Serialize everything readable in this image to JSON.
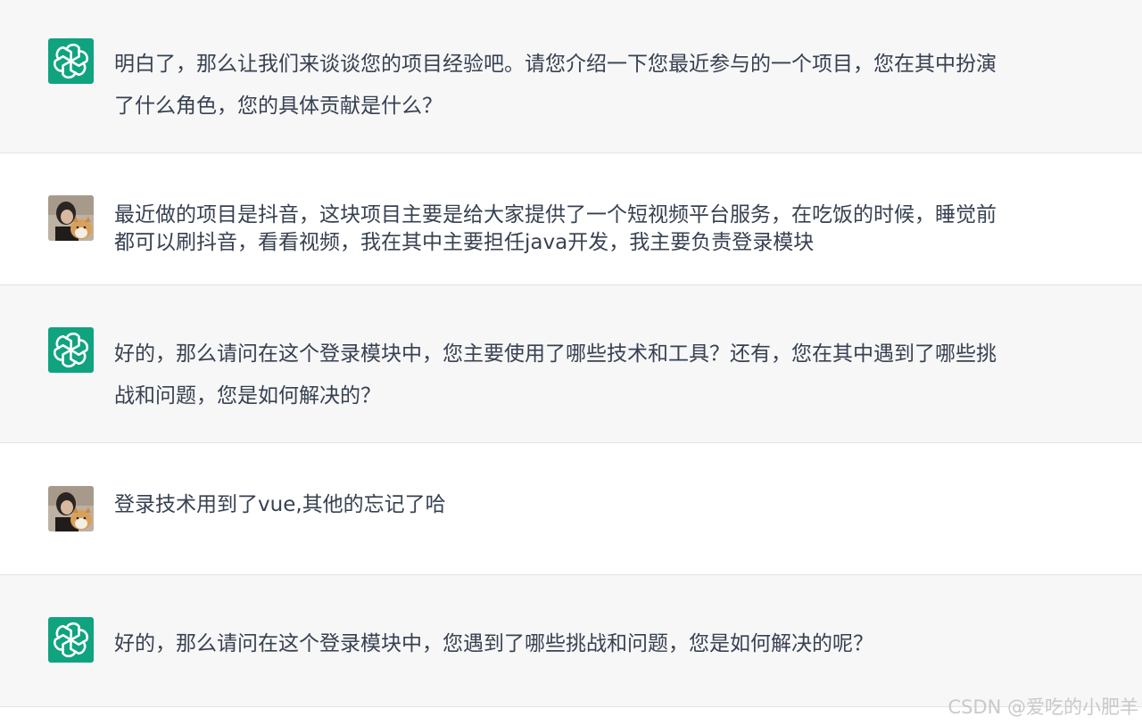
{
  "messages": [
    {
      "role": "assistant",
      "avatar_icon": "openai-logo-icon",
      "text": "明白了，那么让我们来谈谈您的项目经验吧。请您介绍一下您最近参与的一个项目，您在其中扮演了什么角色，您的具体贡献是什么？"
    },
    {
      "role": "user",
      "avatar_icon": "user-avatar-photo",
      "text": "最近做的项目是抖音，这块项目主要是给大家提供了一个短视频平台服务，在吃饭的时候，睡觉前都可以刷抖音，看看视频，我在其中主要担任java开发，我主要负责登录模块"
    },
    {
      "role": "assistant",
      "avatar_icon": "openai-logo-icon",
      "text": "好的，那么请问在这个登录模块中，您主要使用了哪些技术和工具？还有，您在其中遇到了哪些挑战和问题，您是如何解决的？"
    },
    {
      "role": "user",
      "avatar_icon": "user-avatar-photo",
      "text": "登录技术用到了vue,其他的忘记了哈"
    },
    {
      "role": "assistant",
      "avatar_icon": "openai-logo-icon",
      "text": "好的，那么请问在这个登录模块中，您遇到了哪些挑战和问题，您是如何解决的呢？"
    }
  ],
  "watermark": "CSDN @爱吃的小肥羊",
  "colors": {
    "assistant_bg": "#f7f7f8",
    "user_bg": "#ffffff",
    "bot_avatar": "#10a37f",
    "text": "#374151"
  }
}
